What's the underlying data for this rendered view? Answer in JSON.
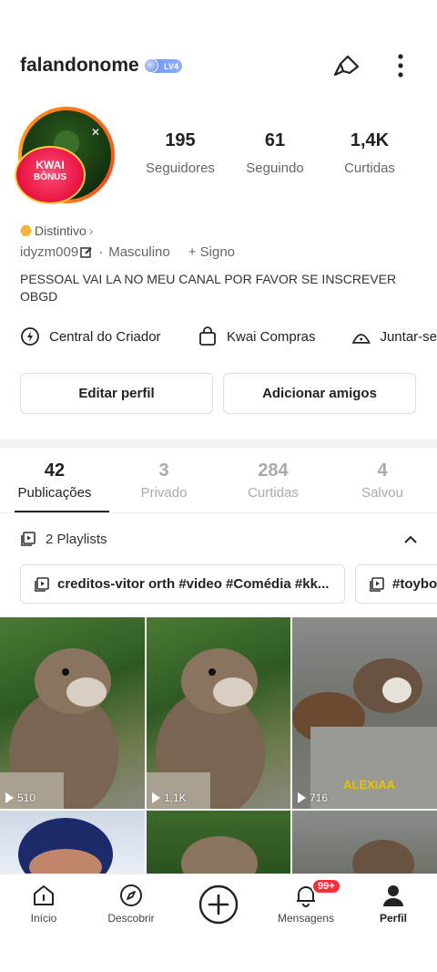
{
  "header": {
    "username": "falandonome",
    "level": "LV4"
  },
  "avatar": {
    "badge_line1": "KWAI",
    "badge_line2": "BÔNUS"
  },
  "stats": [
    {
      "value": "195",
      "label": "Seguidores"
    },
    {
      "value": "61",
      "label": "Seguindo"
    },
    {
      "value": "1,4K",
      "label": "Curtidas"
    }
  ],
  "profile": {
    "distintivo": "Distintivo",
    "user_id": "idyzm009",
    "gender": "Masculino",
    "signo": "+ Signo",
    "bio": "PESSOAL VAI LA NO MEU CANAL POR FAVOR SE INSCREVER OBGD"
  },
  "shortcuts": [
    "Central do Criador",
    "Kwai Compras",
    "Juntar-se"
  ],
  "buttons": {
    "edit": "Editar perfil",
    "add": "Adicionar amigos"
  },
  "tabs": [
    {
      "count": "42",
      "label": "Publicações"
    },
    {
      "count": "3",
      "label": "Privado"
    },
    {
      "count": "284",
      "label": "Curtidas"
    },
    {
      "count": "4",
      "label": "Salvou"
    }
  ],
  "playlists": {
    "title": "2 Playlists",
    "items": [
      "creditos-vitor orth #video #Comédia #kk...",
      "#toyboy"
    ]
  },
  "videos": [
    {
      "views": "510"
    },
    {
      "views": "1,1K"
    },
    {
      "views": "716",
      "watermark": "ALEXIAA"
    }
  ],
  "bottom_nav": {
    "items": [
      "Início",
      "Descobrir",
      "",
      "Mensagens",
      "Perfil"
    ],
    "badge": "99+"
  },
  "colors": {
    "accent": "#ff2d3a",
    "avatar_ring": "#ff7a1a",
    "level_badge": "#6d8df5"
  }
}
